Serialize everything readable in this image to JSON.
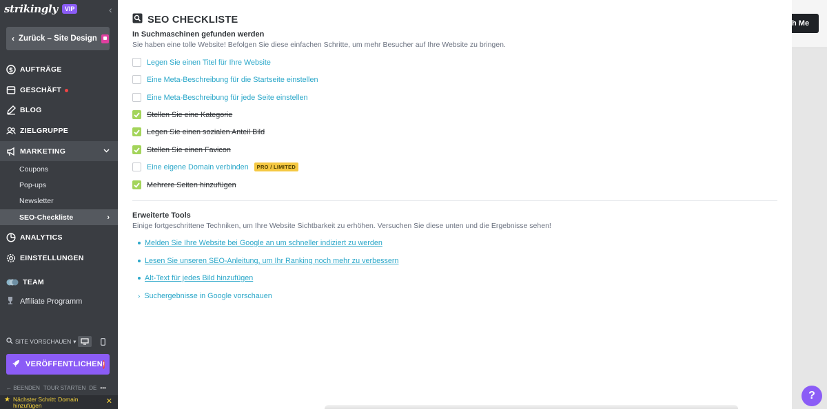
{
  "brand": {
    "name": "strikingly",
    "badge": "VIP"
  },
  "sidebar": {
    "back_label": "Zurück – Site Design",
    "nav": [
      {
        "label": "AUFTRÄGE",
        "icon": "dollar-circle-icon"
      },
      {
        "label": "GESCHÄFT",
        "icon": "store-icon"
      },
      {
        "label": "BLOG",
        "icon": "pen-icon"
      },
      {
        "label": "ZIELGRUPPE",
        "icon": "users-icon"
      },
      {
        "label": "MARKETING",
        "icon": "megaphone-icon"
      }
    ],
    "marketing_sub": [
      "Coupons",
      "Pop-ups",
      "Newsletter",
      "SEO-Checkliste"
    ],
    "nav2": [
      {
        "label": "ANALYTICS",
        "icon": "pie-chart-icon"
      },
      {
        "label": "EINSTELLUNGEN",
        "icon": "gear-icon"
      },
      {
        "label": "TEAM",
        "icon": "team-icon"
      }
    ],
    "affiliate_label": "Affiliate Programm",
    "preview_label": "SITE VORSCHAUEN",
    "publish_label": "VERÖFFENTLICHEN",
    "publish_alert": "!",
    "tour": {
      "end": "BEENDEN",
      "start": "TOUR STARTEN",
      "lang": "DE",
      "more": "•••"
    },
    "next_step": "Nächster Schritt: Domain hinzufügen"
  },
  "panel": {
    "title": "SEO CHECKLISTE",
    "section1": {
      "heading": "In Suchmaschinen gefunden werden",
      "desc": "Sie haben eine tolle Website! Befolgen Sie diese einfachen Schritte, um mehr Besucher auf Ihre Website zu bringen.",
      "items": [
        {
          "label": "Legen Sie einen Titel für Ihre Website",
          "checked": false
        },
        {
          "label": "Eine Meta-Beschreibung für die Startseite einstellen",
          "checked": false
        },
        {
          "label": "Eine Meta-Beschreibung für jede Seite einstellen",
          "checked": false
        },
        {
          "label": "Stellen Sie eine Kategorie",
          "checked": true
        },
        {
          "label": "Legen Sie einen sozialen Anteil Bild",
          "checked": true
        },
        {
          "label": "Stellen Sie einen Favicon",
          "checked": true
        },
        {
          "label": "Eine eigene Domain verbinden",
          "checked": false,
          "badge": "PRO / LIMITED"
        },
        {
          "label": "Mehrere Seiten hinzufügen",
          "checked": true
        }
      ]
    },
    "section2": {
      "heading": "Erweiterte Tools",
      "desc": "Einige fortgeschrittene Techniken, um Ihre Website Sichtbarkeit zu erhöhen. Versuchen Sie diese unten und die Ergebnisse sehen!",
      "links": [
        "Melden Sie Ihre Website bei Google an um schneller indiziert zu werden",
        "Lesen Sie unseren SEO-Anleitung, um Ihr Ranking noch mehr zu verbessern",
        "Alt-Text für jedes Bild hinzufügen"
      ],
      "expand_label": "Suchergebnisse in Google vorschauen"
    }
  },
  "backdrop": {
    "button_text": "h Me",
    "help": "?"
  },
  "colors": {
    "accent": "#2aa7c9",
    "purple": "#8b5cf6",
    "check": "#a3d45a",
    "sidebar": "#3a3d42"
  }
}
